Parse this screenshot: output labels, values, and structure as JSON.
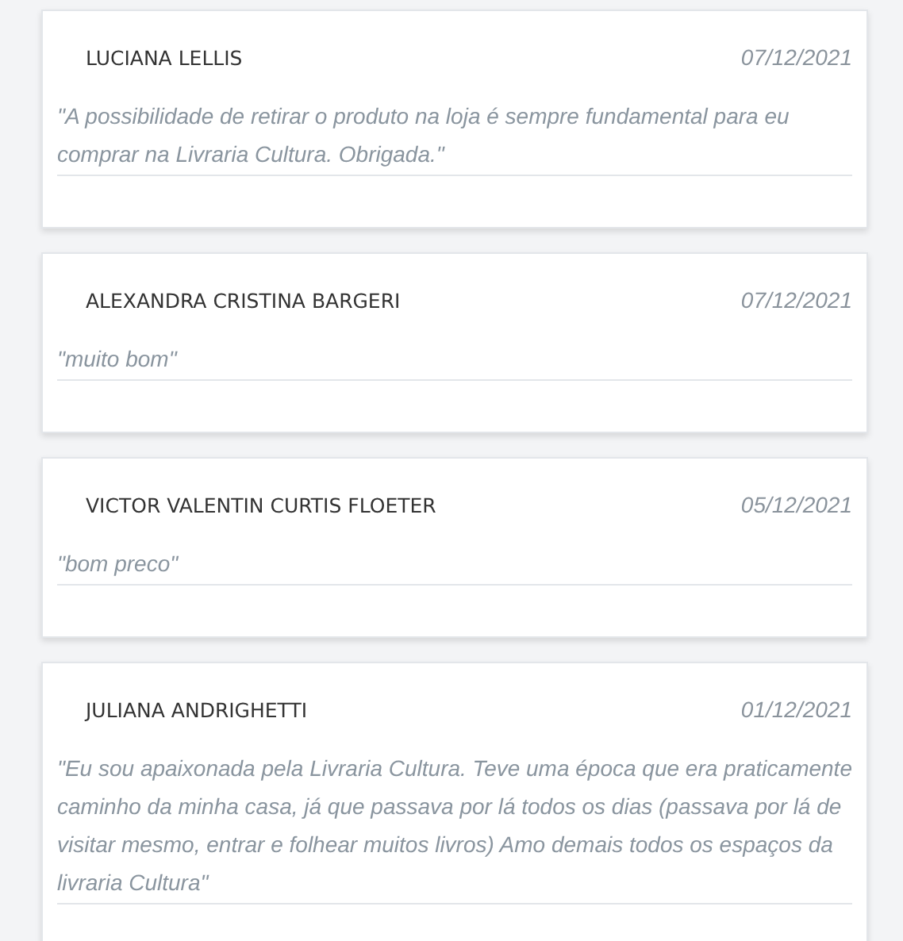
{
  "reviews": [
    {
      "name": "LUCIANA LELLIS",
      "date": "07/12/2021",
      "comment": "\"A possibilidade de retirar o produto na loja é sempre fundamental para eu comprar na Livraria Cultura. Obrigada.\""
    },
    {
      "name": "ALEXANDRA CRISTINA BARGERI",
      "date": "07/12/2021",
      "comment": "\"muito bom\""
    },
    {
      "name": "VICTOR VALENTIN CURTIS FLOETER",
      "date": "05/12/2021",
      "comment": "\"bom preco\""
    },
    {
      "name": "JULIANA ANDRIGHETTI",
      "date": "01/12/2021",
      "comment": "\"Eu sou apaixonada pela Livraria Cultura. Teve uma época que era praticamente caminho da minha casa, já que passava por lá todos os dias (passava por lá de visitar mesmo, entrar e folhear muitos livros) Amo demais todos os espaços da livraria Cultura\""
    }
  ]
}
